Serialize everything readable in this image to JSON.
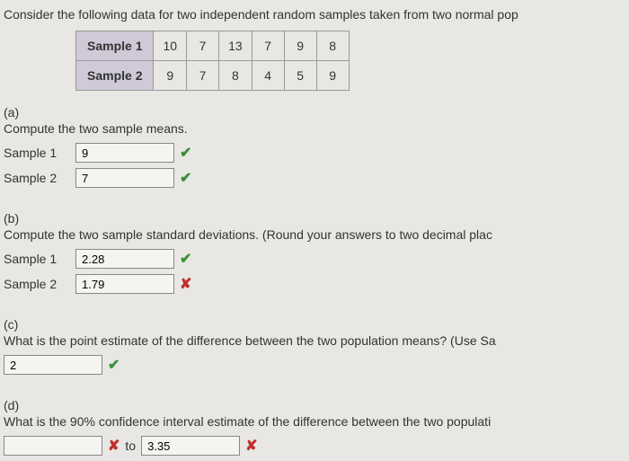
{
  "intro": "Consider the following data for two independent random samples taken from two normal pop",
  "table": {
    "row1_label": "Sample 1",
    "row1_values": [
      "10",
      "7",
      "13",
      "7",
      "9",
      "8"
    ],
    "row2_label": "Sample 2",
    "row2_values": [
      "9",
      "7",
      "8",
      "4",
      "5",
      "9"
    ]
  },
  "partA": {
    "label": "(a)",
    "question": "Compute the two sample means.",
    "sample1_label": "Sample 1",
    "sample1_value": "9",
    "sample2_label": "Sample 2",
    "sample2_value": "7"
  },
  "partB": {
    "label": "(b)",
    "question": "Compute the two sample standard deviations. (Round your answers to two decimal plac",
    "sample1_label": "Sample 1",
    "sample1_value": "2.28",
    "sample2_label": "Sample 2",
    "sample2_value": "1.79"
  },
  "partC": {
    "label": "(c)",
    "question": "What is the point estimate of the difference between the two population means? (Use Sa",
    "value": "2"
  },
  "partD": {
    "label": "(d)",
    "question": "What is the 90% confidence interval estimate of the difference between the two populati",
    "lower_value": "",
    "to_label": "to",
    "upper_value": "3.35"
  }
}
